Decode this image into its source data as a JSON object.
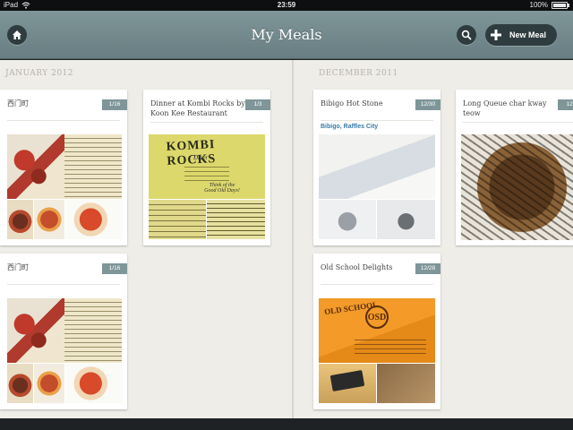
{
  "status_bar": {
    "device": "iPad",
    "time": "23:59",
    "battery": "100%"
  },
  "nav": {
    "title": "My Meals",
    "new_meal_label": "New Meal"
  },
  "months": [
    {
      "label": "JANUARY 2012",
      "cards": [
        {
          "title": "西门町",
          "date": "1/16"
        },
        {
          "title": "Dinner at Kombi Rocks by Koon Kee Restaurant",
          "date": "1/3"
        },
        {
          "title": "西门町",
          "date": "1/16"
        }
      ]
    },
    {
      "label": "DECEMBER 2011",
      "cards": [
        {
          "title": "Bibigo Hot Stone",
          "date": "12/30",
          "location": "Bibigo, Raffles City"
        },
        {
          "title": "Long Queue char kway teow",
          "date": "12/"
        },
        {
          "title": "Old School Delights",
          "date": "12/28"
        }
      ]
    }
  ],
  "photo_text": {
    "kombi_logo": "KOMBI ROCKS",
    "kombi_sub": "Diner",
    "kombi_tagline": "Think of the Good Old Days!",
    "oldschool_logo": "OLD SCHOOL",
    "oldschool_seal": "OSD"
  }
}
